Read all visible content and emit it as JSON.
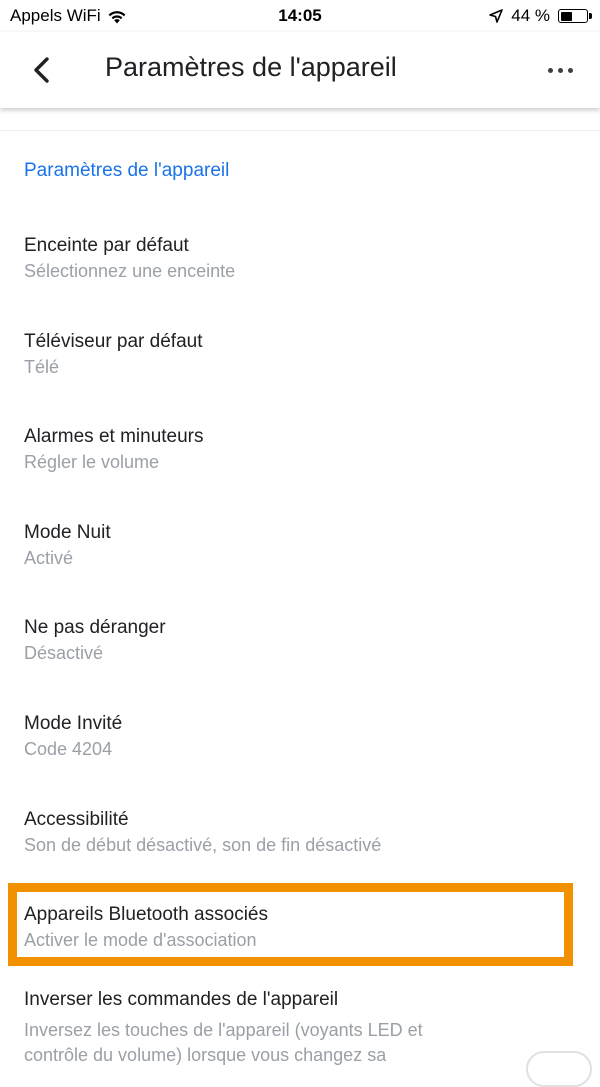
{
  "status_bar": {
    "carrier": "Appels WiFi",
    "time": "14:05",
    "battery_text": "44 %",
    "battery_level": 0.44
  },
  "app_bar": {
    "title": "Paramètres de l'appareil",
    "back_icon": "back-arrow-icon",
    "more_icon": "more-horizontal-icon"
  },
  "section_header": "Paramètres de l'appareil",
  "settings": [
    {
      "title": "Enceinte par défaut",
      "subtitle": "Sélectionnez une enceinte"
    },
    {
      "title": "Téléviseur par défaut",
      "subtitle": "Télé"
    },
    {
      "title": "Alarmes et minuteurs",
      "subtitle": "Régler le volume"
    },
    {
      "title": "Mode Nuit",
      "subtitle": "Activé"
    },
    {
      "title": "Ne pas déranger",
      "subtitle": "Désactivé"
    },
    {
      "title": "Mode Invité",
      "subtitle": "Code 4204"
    },
    {
      "title": "Accessibilité",
      "subtitle": "Son de début désactivé, son de fin désactivé"
    },
    {
      "title": "Appareils Bluetooth associés",
      "subtitle": "Activer le mode d'association"
    }
  ],
  "last_setting": {
    "title": "Inverser les commandes de l'appareil",
    "description": "Inversez les touches de l'appareil (voyants LED et contrôle du volume) lorsque vous changez sa",
    "toggle_on": false
  },
  "colors": {
    "accent": "#1a73e8",
    "highlight": "#f29100",
    "subtitle": "#9aa0a6"
  }
}
